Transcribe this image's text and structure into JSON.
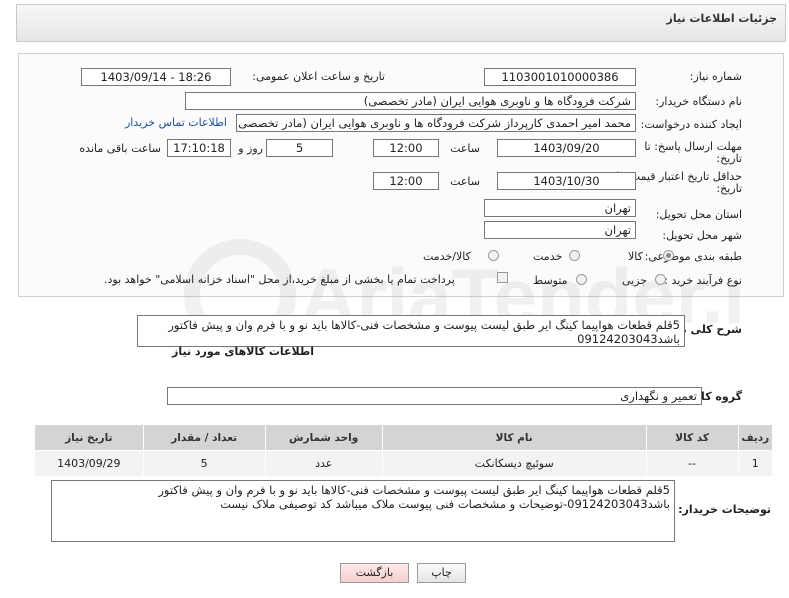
{
  "header": {
    "title": "جزئیات اطلاعات نیاز"
  },
  "fields": {
    "need_number": {
      "label": "شماره نیاز:",
      "value": "1103001010000386"
    },
    "announce_datetime": {
      "label": "تاریخ و ساعت اعلان عمومی:",
      "value": "1403/09/14 - 18:26"
    },
    "buyer_org": {
      "label": "نام دستگاه خریدار:",
      "value": "شرکت فرودگاه ها و ناوبری هوایی ایران (مادر تخصصی)"
    },
    "requester": {
      "label": "ایجاد کننده درخواست:",
      "value": "محمد امیر احمدی کارپرداز شرکت فرودگاه ها و ناوبری هوایی ایران (مادر تخصصی)",
      "link": "اطلاعات تماس خریدار"
    },
    "response_deadline": {
      "label_line1": "مهلت ارسال پاسخ: تا",
      "label_line2": "تاریخ:",
      "date": "1403/09/20",
      "time_label": "ساعت",
      "time": "12:00",
      "days": "5",
      "days_label": "روز و",
      "remaining": "17:10:18",
      "remaining_label": "ساعت باقی مانده"
    },
    "price_validity": {
      "label_line1": "حداقل تاریخ اعتبار قیمت: تا",
      "label_line2": "تاریخ:",
      "date": "1403/10/30",
      "time_label": "ساعت",
      "time": "12:00"
    },
    "province": {
      "label": "استان محل تحویل:",
      "value": "تهران"
    },
    "city": {
      "label": "شهر محل تحویل:",
      "value": "تهران"
    },
    "category": {
      "label": "طبقه بندی موضوعی:",
      "options": [
        "کالا",
        "خدمت",
        "کالا/خدمت"
      ],
      "selected": "کالا"
    },
    "purchase_type": {
      "label": "نوع فرآیند خرید :",
      "options": [
        "جزیی",
        "متوسط"
      ],
      "payment_note": "پرداخت تمام یا بخشی از مبلغ خرید،از محل \"اسناد خزانه اسلامی\" خواهد بود."
    }
  },
  "summary": {
    "label": "شرح کلی نیاز:",
    "text": "5قلم قطعات هواپیما کینگ ایر طبق لیست پیوست و مشخصات فنی-کالاها باید نو و با فرم وان و پیش فاکتور باشد09124203043"
  },
  "goods_info_title": "اطلاعات کالاهای مورد نیاز",
  "goods_group": {
    "label": "گروه کالا:",
    "value": "تعمیر و نگهداری"
  },
  "table": {
    "headers": [
      "ردیف",
      "کد کالا",
      "نام کالا",
      "واحد شمارش",
      "تعداد / مقدار",
      "تاریخ نیاز"
    ],
    "rows": [
      [
        "1",
        "--",
        "سوئیچ دیسکانکت",
        "عدد",
        "5",
        "1403/09/29"
      ]
    ]
  },
  "buyer_notes": {
    "label": "توضیحات خریدار:",
    "line1": "5قلم قطعات هواپیما کینگ ایر طبق لیست پیوست و مشخصات فنی-کالاها باید نو و با فرم وان و پیش فاکتور",
    "line2": "باشد09124203043-توضیحات و مشخصات فنی پیوست ملاک میباشد کد توصیفی ملاک نیست"
  },
  "buttons": {
    "print": "چاپ",
    "back": "بازگشت"
  },
  "watermark": "AriaTender.net"
}
